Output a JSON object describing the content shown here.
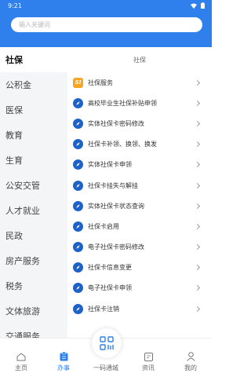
{
  "status_bar": {
    "time": "9:21"
  },
  "search": {
    "placeholder": "输入关键词"
  },
  "sidebar": {
    "items": [
      {
        "label": "社保",
        "active": true
      },
      {
        "label": "公积金"
      },
      {
        "label": "医保"
      },
      {
        "label": "教育"
      },
      {
        "label": "生育"
      },
      {
        "label": "公安交管"
      },
      {
        "label": "人才就业"
      },
      {
        "label": "民政"
      },
      {
        "label": "房产服务"
      },
      {
        "label": "税务"
      },
      {
        "label": "文体旅游"
      },
      {
        "label": "交通服务"
      }
    ]
  },
  "content": {
    "title": "社保",
    "items": [
      {
        "label": "社保服务",
        "icon": "si-logo-icon"
      },
      {
        "label": "高校毕业生社保补贴申领",
        "icon": "compass-icon"
      },
      {
        "label": "实体社保卡密码修改",
        "icon": "compass-icon"
      },
      {
        "label": "社保卡补领、换领、换发",
        "icon": "compass-icon"
      },
      {
        "label": "实体社保卡申领",
        "icon": "compass-icon"
      },
      {
        "label": "社保卡挂失与解挂",
        "icon": "compass-icon"
      },
      {
        "label": "实体社保卡状态查询",
        "icon": "compass-icon"
      },
      {
        "label": "社保卡启用",
        "icon": "compass-icon"
      },
      {
        "label": "电子社保卡密码修改",
        "icon": "compass-icon"
      },
      {
        "label": "社保卡信息变更",
        "icon": "compass-icon"
      },
      {
        "label": "电子社保卡申领",
        "icon": "compass-icon"
      },
      {
        "label": "社保卡注销",
        "icon": "compass-icon"
      }
    ]
  },
  "tabbar": {
    "home": "主页",
    "services": "办事",
    "center": "一码通城",
    "news": "资讯",
    "mine": "我的"
  },
  "colors": {
    "primary": "#2f80ed",
    "icon_blue": "#1d62c8",
    "si_orange": "#f5a623"
  }
}
